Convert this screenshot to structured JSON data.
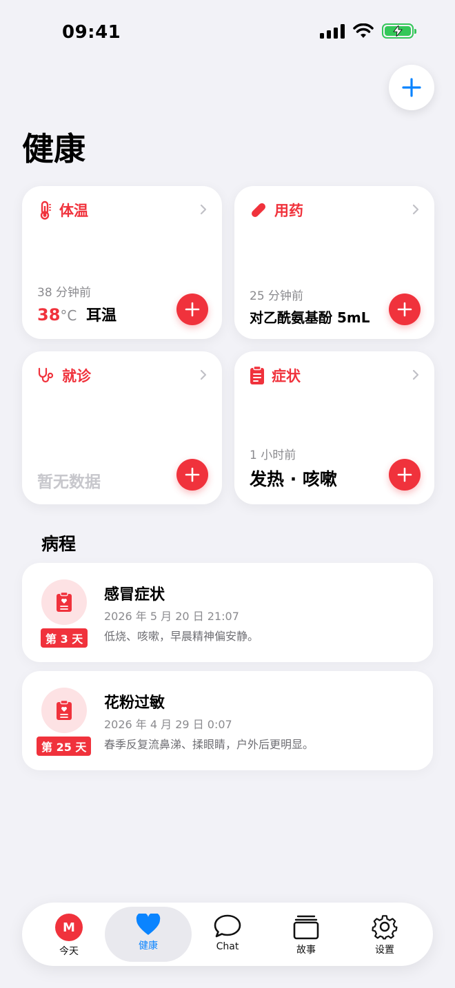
{
  "status_bar": {
    "time": "09:41"
  },
  "page": {
    "title": "健康"
  },
  "cards": {
    "temperature": {
      "title": "体温",
      "time": "38 分钟前",
      "value": "38",
      "unit": "°C",
      "method": "耳温"
    },
    "medication": {
      "title": "用药",
      "time": "25 分钟前",
      "value": "对乙酰氨基酚 5mL"
    },
    "visit": {
      "title": "就诊",
      "empty": "暂无数据"
    },
    "symptoms": {
      "title": "症状",
      "time": "1 小时前",
      "value": "发热 · 咳嗽"
    }
  },
  "episodes_section": {
    "title": "病程",
    "items": [
      {
        "badge": "第 3 天",
        "name": "感冒症状",
        "date": "2026 年 5 月 20 日 21:07",
        "desc": "低烧、咳嗽，早晨精神偏安静。"
      },
      {
        "badge": "第 25 天",
        "name": "花粉过敏",
        "date": "2026 年 4 月 29 日 0:07",
        "desc": "春季反复流鼻涕、揉眼睛，户外后更明显。"
      }
    ]
  },
  "tab_bar": {
    "avatar_initial": "M",
    "tabs": [
      {
        "label": "今天"
      },
      {
        "label": "健康"
      },
      {
        "label": "Chat"
      },
      {
        "label": "故事"
      },
      {
        "label": "设置"
      }
    ],
    "active_index": 1
  },
  "colors": {
    "accent_red": "#f0323c",
    "accent_blue": "#0a84ff",
    "battery_green": "#34c759",
    "background": "#f2f2f7"
  }
}
